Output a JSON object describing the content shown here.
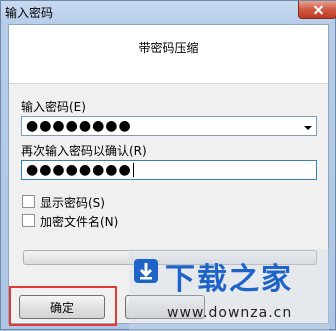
{
  "window": {
    "title": "输入密码"
  },
  "dialog": {
    "heading": "带密码压缩"
  },
  "password": {
    "label": "输入密码(E)",
    "masked_value": "●●●●●●●●"
  },
  "confirm": {
    "label": "再次输入密码以确认(R)",
    "masked_value": "●●●●●●●●"
  },
  "options": [
    {
      "label": "显示密码(S)",
      "checked": false
    },
    {
      "label": "加密文件名(N)",
      "checked": false
    }
  ],
  "buttons": {
    "ok": "确定"
  },
  "watermark": {
    "brand": "下载之家",
    "url": "www.downza.cn"
  },
  "colors": {
    "highlight": "#e53935",
    "brand_blue": "#1e63c8"
  }
}
